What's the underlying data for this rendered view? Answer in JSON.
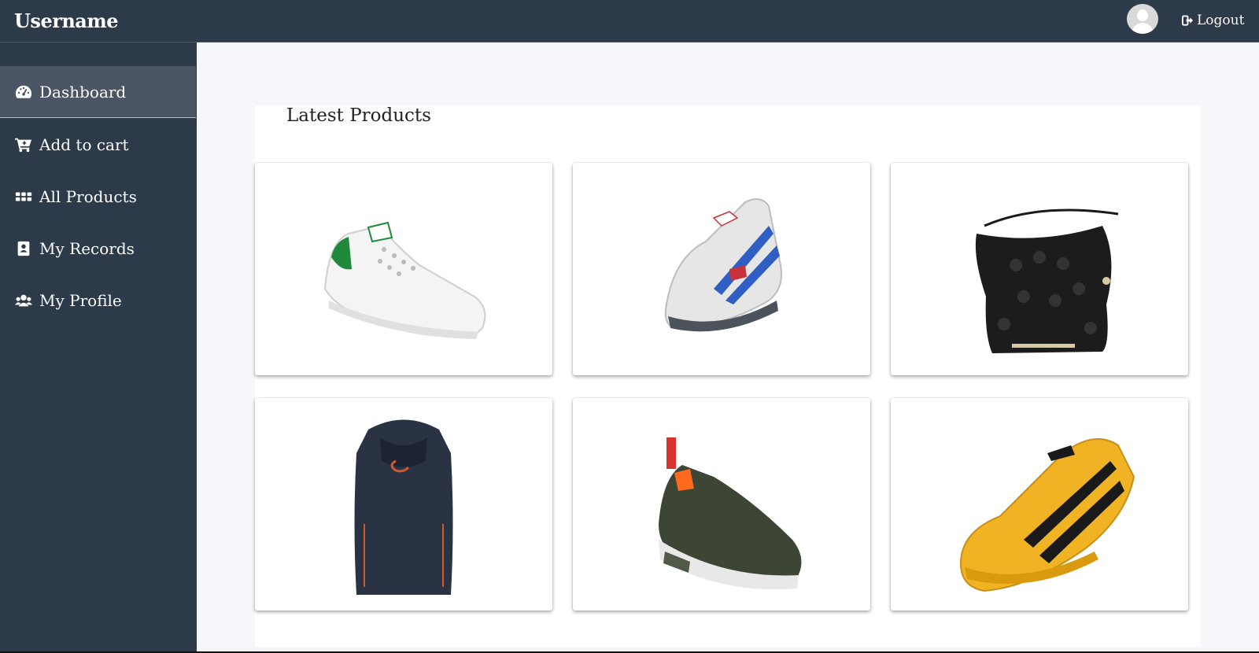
{
  "header": {
    "brand": "Username",
    "logout_label": "Logout"
  },
  "sidebar": {
    "items": [
      {
        "label": "Dashboard",
        "icon": "dashboard-icon",
        "active": true
      },
      {
        "label": "Add to cart",
        "icon": "cart-icon",
        "active": false
      },
      {
        "label": "All Products",
        "icon": "grid-icon",
        "active": false
      },
      {
        "label": "My Records",
        "icon": "address-book-icon",
        "active": false
      },
      {
        "label": "My Profile",
        "icon": "users-icon",
        "active": false
      }
    ]
  },
  "main": {
    "section_title": "Latest Products",
    "products": [
      {
        "name": "white-sneaker-green-heel",
        "colors": [
          "#ffffff",
          "#1f8a3c"
        ]
      },
      {
        "name": "white-blue-running-shoe",
        "colors": [
          "#e6e6e6",
          "#2f5fc4",
          "#c8323c"
        ]
      },
      {
        "name": "black-croc-handbag",
        "colors": [
          "#1a1a1a",
          "#d9c9a3"
        ]
      },
      {
        "name": "navy-sleeveless-hoodie",
        "colors": [
          "#2a3344",
          "#d4562a"
        ]
      },
      {
        "name": "olive-knit-sneaker",
        "colors": [
          "#3d4535",
          "#ff6a1f",
          "#d8332f"
        ]
      },
      {
        "name": "yellow-black-stripe-shoe",
        "colors": [
          "#f0b323",
          "#1a1a1a"
        ]
      }
    ]
  },
  "colors": {
    "navy": "#2c3a4a",
    "active_item": "#4b5563",
    "content_bg": "#f6f7fb"
  }
}
